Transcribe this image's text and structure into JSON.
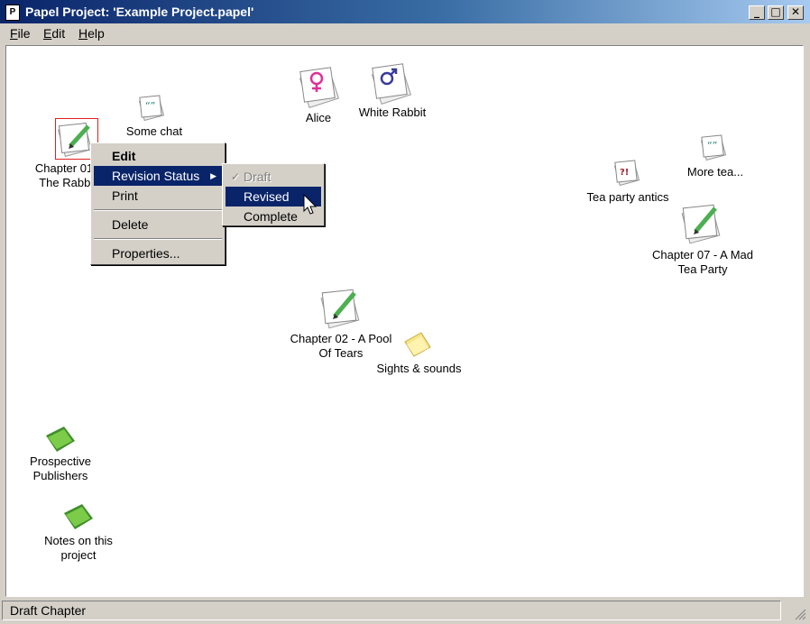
{
  "window": {
    "title": "Papel Project: 'Example Project.papel'",
    "app_icon": "P"
  },
  "menubar": {
    "file": {
      "key": "F",
      "rest": "ile"
    },
    "edit": {
      "key": "E",
      "rest": "dit"
    },
    "help": {
      "key": "H",
      "rest": "elp"
    }
  },
  "nodes": {
    "alice": "Alice",
    "white_rabbit": "White Rabbit",
    "some_chat": "Some chat",
    "chapter01": "Chapter 01 -\nThe Rabbit",
    "tea_party_antics": "Tea party antics",
    "more_tea": "More tea...",
    "chapter07": "Chapter 07 -  A Mad\nTea Party",
    "chapter02": "Chapter 02 - A Pool\nOf Tears",
    "sights_sounds": "Sights & sounds",
    "prospective": "Prospective\nPublishers",
    "notes": "Notes on this\nproject"
  },
  "context_menu": {
    "edit": "Edit",
    "revision_status": "Revision Status",
    "print": "Print",
    "delete": "Delete",
    "properties": "Properties..."
  },
  "submenu": {
    "draft": "Draft",
    "revised": "Revised",
    "complete": "Complete"
  },
  "status": {
    "text": "Draft Chapter"
  },
  "colors": {
    "accent": "#0a246a",
    "female": "#e0309a",
    "male": "#3a3a9a",
    "book": "#5fb83a",
    "pencil": "#4caf50"
  }
}
